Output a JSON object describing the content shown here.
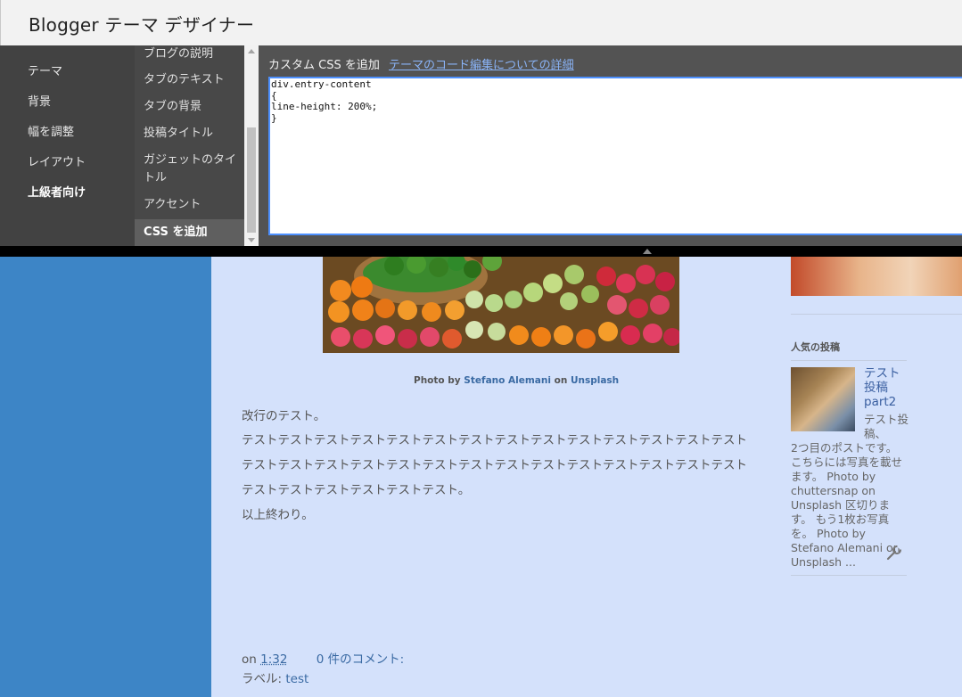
{
  "header": {
    "title": "Blogger テーマ デザイナー"
  },
  "nav_primary": [
    {
      "label": "テーマ"
    },
    {
      "label": "背景"
    },
    {
      "label": "幅を調整"
    },
    {
      "label": "レイアウト"
    },
    {
      "label": "上級者向け",
      "active": true
    }
  ],
  "nav_secondary": [
    {
      "label": "ブログの説明"
    },
    {
      "label": "タブのテキスト"
    },
    {
      "label": "タブの背景"
    },
    {
      "label": "投稿タイトル"
    },
    {
      "label": "ガジェットのタイトル"
    },
    {
      "label": "アクセント"
    },
    {
      "label": "CSS を追加",
      "active": true
    }
  ],
  "css_panel": {
    "heading": "カスタム CSS を追加",
    "link": "テーマのコード編集についての詳細",
    "code": "div.entry-content\n{\nline-height: 200%;\n}\n"
  },
  "post": {
    "photo_credit": {
      "prefix": "Photo by",
      "author": "Stefano Alemani",
      "on": "on",
      "source": "Unsplash"
    },
    "body": [
      "改行のテスト。",
      "テストテストテストテストテストテストテストテストテストテストテストテストテストテストテストテストテストテストテストテストテストテストテストテストテストテストテストテストテストテストテストテストテストテスト。",
      "以上終わり。"
    ],
    "footer": {
      "on": "on",
      "time": "1:32",
      "comments": "0 件のコメント:",
      "labels_prefix": "ラベル:",
      "label": "test"
    }
  },
  "sidebar": {
    "popular_heading": "人気の投稿",
    "popular_post": {
      "title": "テスト投稿part2",
      "snippet_lead": "テスト投稿、",
      "snippet_rest": "2つ目のポストです。 こちらには写真を載せます。 Photo by chuttersnap on Unsplash 区切ります。 もう1枚お写真を。 Photo by Stefano Alemani on Unsplash ..."
    }
  },
  "icons": {
    "edit": "wrench-icon"
  },
  "colors": {
    "left_bar": "#3d85c6",
    "preview_bg": "#d4e1fb",
    "editor_border": "#4d90fe"
  }
}
